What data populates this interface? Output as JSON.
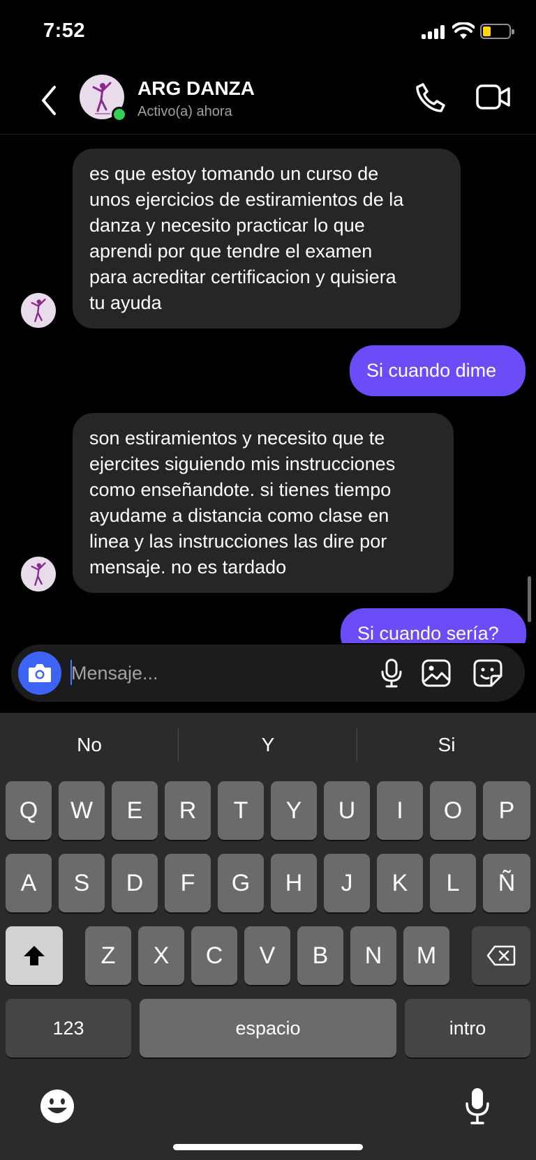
{
  "status_bar": {
    "time": "7:52"
  },
  "header": {
    "contact_name": "ARG DANZA",
    "contact_status": "Activo(a) ahora"
  },
  "messages": [
    {
      "direction": "incoming",
      "text_lines": [
        "es que estoy tomando un curso de",
        "unos ejercicios de estiramientos de la",
        "danza y necesito practicar lo que",
        "aprendi por que tendre el examen",
        "para acreditar certificacion y quisiera",
        "tu ayuda"
      ]
    },
    {
      "direction": "outgoing",
      "text": "Si cuando dime"
    },
    {
      "direction": "incoming",
      "text_lines": [
        "son estiramientos y necesito que te",
        "ejercites siguiendo mis instrucciones",
        "como enseñandote. si tienes tiempo",
        "ayudame a distancia como clase en",
        "linea y las instrucciones las dire por",
        "mensaje. no es tardado"
      ]
    },
    {
      "direction": "outgoing",
      "text": "Si cuando sería?"
    }
  ],
  "composer": {
    "placeholder": "Mensaje..."
  },
  "keyboard": {
    "suggestions": [
      "No",
      "Y",
      "Si"
    ],
    "row1": [
      "Q",
      "W",
      "E",
      "R",
      "T",
      "Y",
      "U",
      "I",
      "O",
      "P"
    ],
    "row2": [
      "A",
      "S",
      "D",
      "F",
      "G",
      "H",
      "J",
      "K",
      "L",
      "Ñ"
    ],
    "row3": [
      "Z",
      "X",
      "C",
      "V",
      "B",
      "N",
      "M"
    ],
    "numbers_label": "123",
    "space_label": "espacio",
    "return_label": "intro"
  }
}
